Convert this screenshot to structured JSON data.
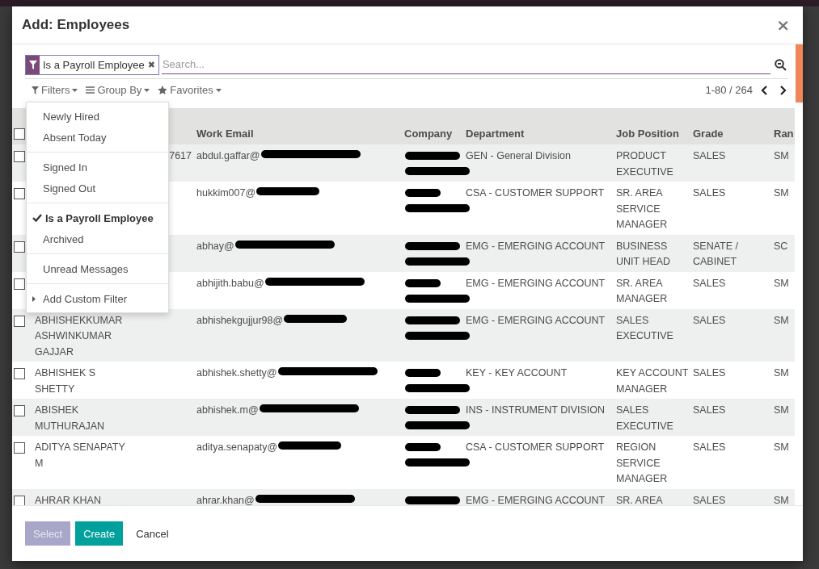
{
  "dialog": {
    "title": "Add: Employees",
    "close": "×"
  },
  "search": {
    "facet": {
      "label": "Is a Payroll Employee",
      "remove": "✖"
    },
    "placeholder": "Search..."
  },
  "toolbar": {
    "filters": "Filters",
    "group_by": "Group By",
    "favorites": "Favorites",
    "pager": "1-80 / 264"
  },
  "filter_menu": [
    [
      {
        "label": "Newly Hired",
        "checked": false
      },
      {
        "label": "Absent Today",
        "checked": false
      }
    ],
    [
      {
        "label": "Signed In",
        "checked": false
      },
      {
        "label": "Signed Out",
        "checked": false
      }
    ],
    [
      {
        "label": "Is a Payroll Employee",
        "checked": true
      },
      {
        "label": "Archived",
        "checked": false
      }
    ],
    [
      {
        "label": "Unread Messages",
        "checked": false
      }
    ],
    [
      {
        "label": "Add Custom Filter",
        "checked": false,
        "kind": "submenu"
      }
    ]
  ],
  "table": {
    "select_all": {
      "checked": false
    },
    "columns": [
      "Work Email",
      "Company",
      "Department",
      "Job Position",
      "Grade",
      "Ran"
    ],
    "rows": [
      {
        "kind": "cut",
        "checked": false,
        "name": "7617",
        "email": "abdul.gaffar@",
        "department": "GEN - General Division",
        "job": "PRODUCT EXECUTIVE",
        "grade": "SALES",
        "rank": "SM"
      },
      {
        "kind": "cut",
        "checked": false,
        "email": "hukkim007@",
        "department": "CSA - CUSTOMER SUPPORT",
        "job": "SR. AREA SERVICE MANAGER",
        "grade": "SALES",
        "rank": "SM"
      },
      {
        "kind": "cut",
        "checked": false,
        "email": "abhay@",
        "department": "EMG - EMERGING ACCOUNT",
        "job": "BUSINESS UNIT HEAD",
        "grade": "SENATE / CABINET",
        "rank": "SC"
      },
      {
        "kind": "cut",
        "checked": false,
        "email": "abhijith.babu@",
        "department": "EMG - EMERGING ACCOUNT",
        "job": "SR. AREA MANAGER",
        "grade": "SALES",
        "rank": "SM"
      },
      {
        "kind": "full",
        "checked": false,
        "name": "ABHISHEKKUMAR ASHWINKUMAR GAJJAR",
        "email": "abhishekgujjur98@",
        "department": "EMG - EMERGING ACCOUNT",
        "job": "SALES EXECUTIVE",
        "grade": "SALES",
        "rank": "SM"
      },
      {
        "kind": "full",
        "checked": false,
        "name": "ABHISHEK S SHETTY",
        "email": "abhishek.shetty@",
        "department": "KEY - KEY ACCOUNT",
        "job": "KEY ACCOUNT MANAGER",
        "grade": "SALES",
        "rank": "SM"
      },
      {
        "kind": "full",
        "checked": false,
        "name": "ABISHEK MUTHURAJAN",
        "email": "abhishek.m@",
        "department": "INS - INSTRUMENT DIVISION",
        "job": "SALES EXECUTIVE",
        "grade": "SALES",
        "rank": "SM"
      },
      {
        "kind": "full",
        "checked": false,
        "name": "ADITYA SENAPATY M",
        "email": "aditya.senapaty@",
        "department": "CSA - CUSTOMER SUPPORT",
        "job": "REGION SERVICE MANAGER",
        "grade": "SALES",
        "rank": "SM"
      },
      {
        "kind": "full",
        "checked": false,
        "name": "AHRAR KHAN",
        "email": "ahrar.khan@",
        "department": "EMG - EMERGING ACCOUNT",
        "job": "SR. AREA",
        "grade": "SALES",
        "rank": "SM"
      }
    ]
  },
  "buttons": [
    {
      "label": "Select",
      "kind": "primary",
      "disabled": true
    },
    {
      "label": "Create",
      "kind": "primary",
      "disabled": false
    },
    {
      "label": "Cancel",
      "kind": "link",
      "disabled": false
    }
  ]
}
